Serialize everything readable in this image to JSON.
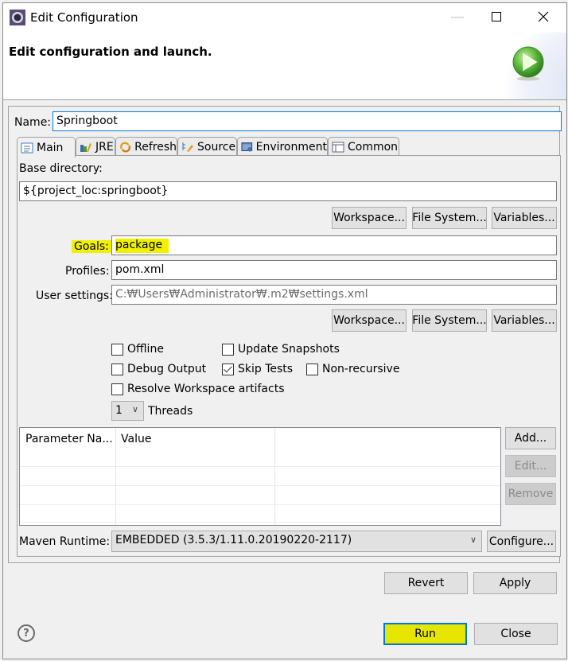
{
  "window": {
    "title": "Edit Configuration",
    "icon": "eclipse-gear-icon"
  },
  "banner": {
    "title": "Edit configuration and launch.",
    "icon": "run-launch-icon"
  },
  "name_field": {
    "label": "Name:",
    "value": "Springboot"
  },
  "tabs": [
    {
      "label": "Main",
      "icon": "main-tab-icon",
      "active": true
    },
    {
      "label": "JRE",
      "icon": "jre-library-icon",
      "active": false
    },
    {
      "label": "Refresh",
      "icon": "refresh-icon",
      "active": false
    },
    {
      "label": "Source",
      "icon": "source-lookup-icon",
      "active": false
    },
    {
      "label": "Environment",
      "icon": "environment-icon",
      "active": false
    },
    {
      "label": "Common",
      "icon": "common-tab-icon",
      "active": false
    }
  ],
  "main": {
    "base_directory_label": "Base directory:",
    "base_directory_value": "${project_loc:springboot}",
    "browse_buttons": [
      "Workspace...",
      "File System...",
      "Variables..."
    ],
    "goals_label": "Goals:",
    "goals_value": "package",
    "profiles_label": "Profiles:",
    "profiles_value": "pom.xml",
    "user_settings_label": "User settings:",
    "user_settings_value": "C:₩Users₩Administrator₩.m2₩settings.xml",
    "settings_buttons": [
      "Workspace...",
      "File System...",
      "Variables..."
    ],
    "checkboxes": {
      "offline": {
        "label": "Offline",
        "checked": false
      },
      "update_snapshots": {
        "label": "Update Snapshots",
        "checked": false
      },
      "debug_output": {
        "label": "Debug Output",
        "checked": false
      },
      "skip_tests": {
        "label": "Skip Tests",
        "checked": true
      },
      "non_recursive": {
        "label": "Non-recursive",
        "checked": false
      },
      "resolve_workspace": {
        "label": "Resolve Workspace artifacts",
        "checked": false
      }
    },
    "threads_value": "1",
    "threads_label": "Threads",
    "parameters_table": {
      "columns": [
        "Parameter Na...",
        "Value",
        ""
      ],
      "rows": []
    },
    "table_buttons": {
      "add": "Add...",
      "edit": "Edit...",
      "remove": "Remove"
    },
    "maven_runtime_label": "Maven Runtime:",
    "maven_runtime_value": "EMBEDDED (3.5.3/1.11.0.20190220-2117)",
    "configure_button": "Configure..."
  },
  "footer": {
    "revert": "Revert",
    "apply": "Apply",
    "run": "Run",
    "close": "Close",
    "help_symbol": "?"
  },
  "colors": {
    "highlight": "#f0f000",
    "focus_border": "#0078d7"
  }
}
